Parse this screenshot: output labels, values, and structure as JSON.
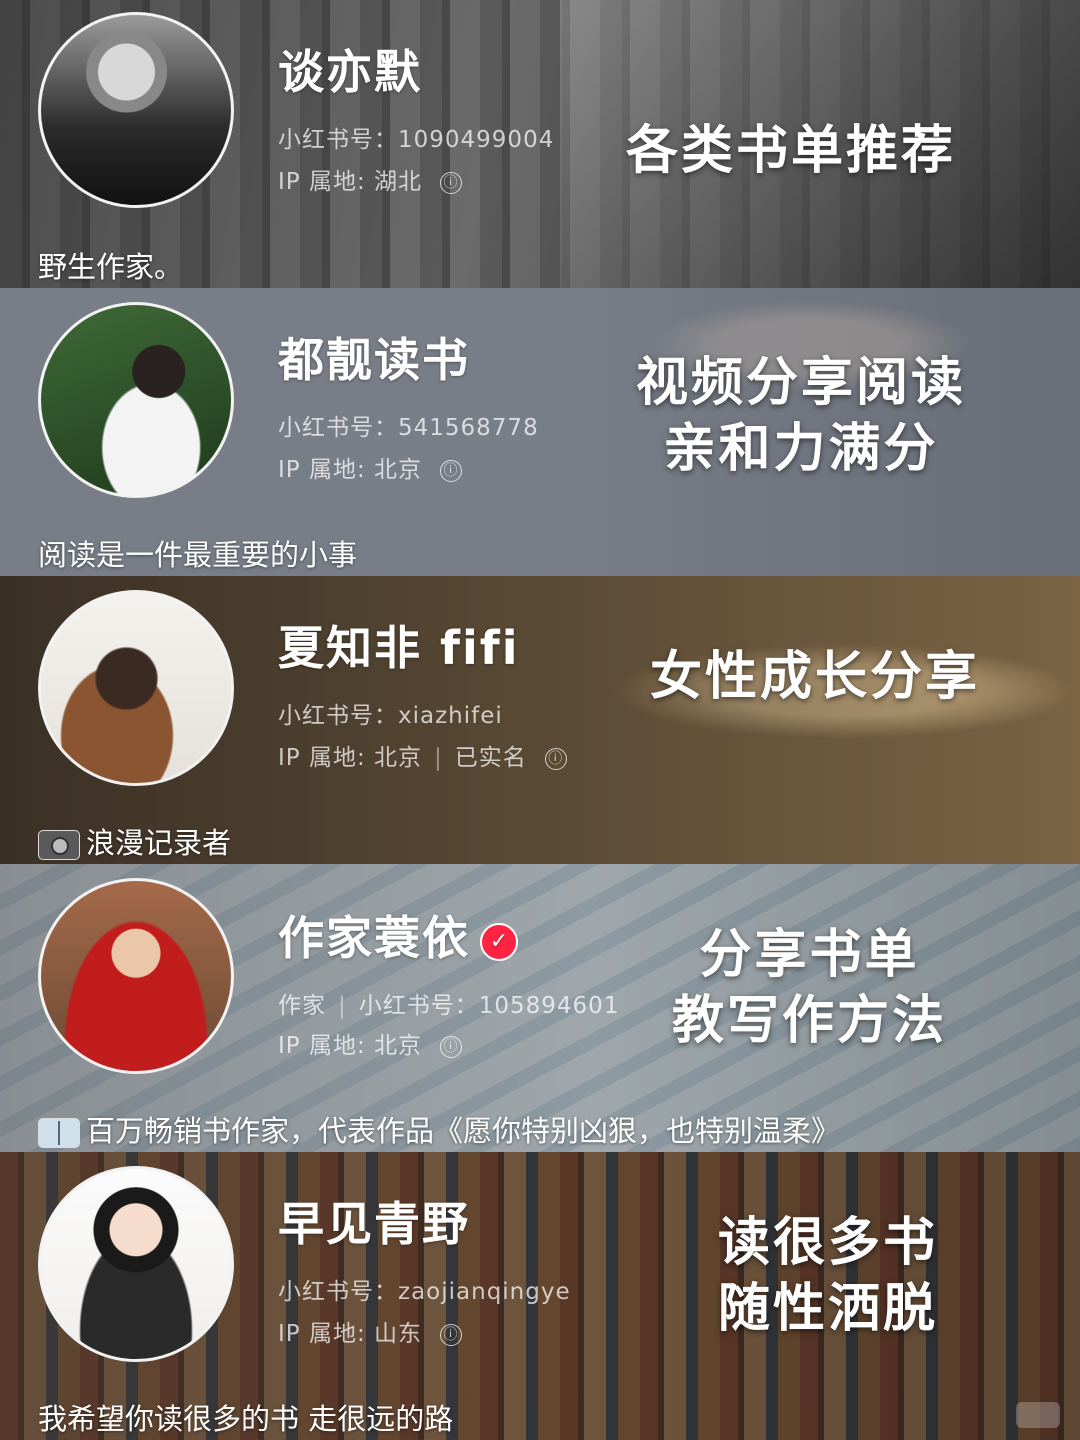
{
  "cards": [
    {
      "name": "谈亦默",
      "id_line": "小红书号：1090499004",
      "ip_line": "IP 属地: 湖北",
      "info_icon": "ⓘ",
      "tagline": [
        "各类书单推荐"
      ],
      "bio": "野生作家。"
    },
    {
      "name": "都靓读书",
      "id_line": "小红书号：541568778",
      "ip_line": "IP 属地: 北京",
      "info_icon": "ⓘ",
      "tagline": [
        "视频分享阅读",
        "亲和力满分"
      ],
      "bio": "阅读是一件最重要的小事"
    },
    {
      "name": "夏知非 fifi",
      "id_line": "小红书号：xiazhifei",
      "ip_line": "IP 属地: 北京",
      "ip_extra": "已实名",
      "info_icon": "ⓘ",
      "tagline": [
        "女性成长分享"
      ],
      "bio": "浪漫记录者",
      "bio_icon": "camera-icon"
    },
    {
      "name": "作家蓑依",
      "verified_icon": "✓",
      "role": "作家",
      "id_line": "小红书号：105894601",
      "ip_line": "IP 属地: 北京",
      "info_icon": "ⓘ",
      "tagline": [
        "分享书单",
        "教写作方法"
      ],
      "bio": "百万畅销书作家，代表作品《愿你特别凶狠，也特别温柔》",
      "bio_icon": "book-icon"
    },
    {
      "name": "早见青野",
      "id_line": "小红书号：zaojianqingye",
      "ip_line": "IP 属地: 山东",
      "info_icon": "ⓘ",
      "tagline": [
        "读很多书",
        "随性洒脱"
      ],
      "bio": "我希望你读很多的书 走很远的路"
    }
  ]
}
